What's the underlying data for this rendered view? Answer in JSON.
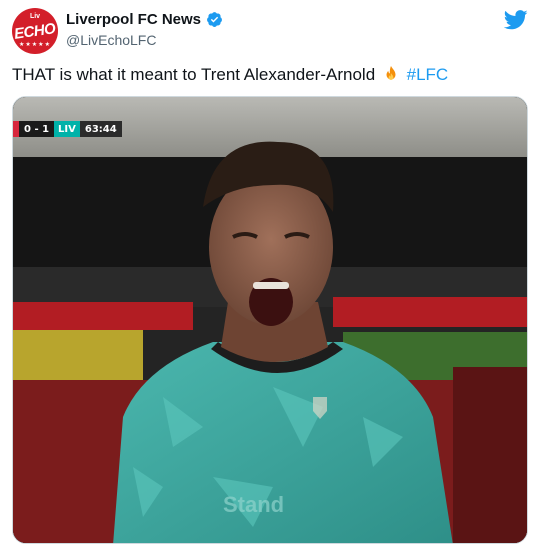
{
  "account": {
    "display_name": "Liverpool FC News",
    "handle": "@LivEchoLFC",
    "avatar_text": "ECHO",
    "avatar_top_text": "Liv",
    "avatar_stars": "★★★★★"
  },
  "tweet": {
    "text": "THAT is what it meant to Trent Alexander-Arnold",
    "hashtag": "#LFC"
  },
  "media": {
    "score_bug": {
      "score": "0 - 1",
      "team": "LIV",
      "clock": "63:44"
    }
  },
  "colors": {
    "brand_blue": "#1d9bf0",
    "avatar_red": "#d31f2a",
    "shirt_teal": "#3aa6a0"
  },
  "icons": [
    "verified-badge-icon",
    "twitter-bird-icon",
    "fire-emoji-icon"
  ]
}
